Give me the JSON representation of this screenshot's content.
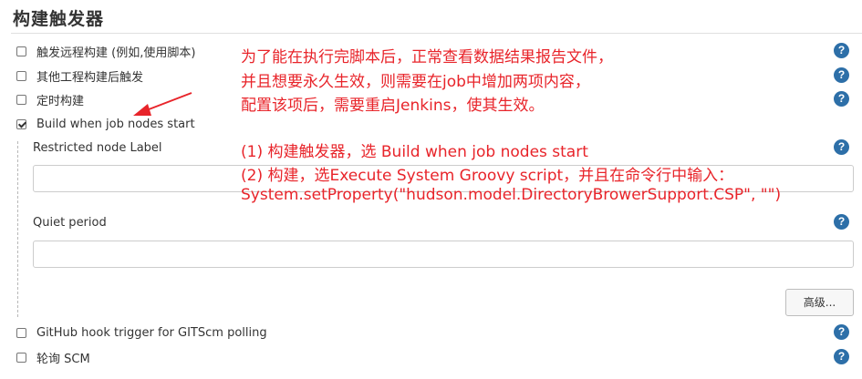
{
  "section": {
    "title": "构建触发器"
  },
  "options": [
    {
      "label": "触发远程构建 (例如,使用脚本)",
      "checked": false
    },
    {
      "label": "其他工程构建后触发",
      "checked": false
    },
    {
      "label": "定时构建",
      "checked": false
    },
    {
      "label": "Build when job nodes start",
      "checked": true
    }
  ],
  "nested": {
    "restricted_label": "Restricted node Label",
    "restricted_value": "",
    "quiet_label": "Quiet period",
    "quiet_value": "",
    "advanced_button": "高级..."
  },
  "options_bottom": [
    {
      "label": "GitHub hook trigger for GITScm polling",
      "checked": false
    },
    {
      "label": "轮询 SCM",
      "checked": false
    }
  ],
  "help_icon": {
    "glyph": "?",
    "color": "#2d6fa8"
  },
  "annotation": {
    "color": "#e8242a",
    "lines": [
      "为了能在执行完脚本后，正常查看数据结果报告文件，",
      "并且想要永久生效，则需要在job中增加两项内容，",
      "配置该项后，需要重启Jenkins，使其生效。",
      "(1) 构建触发器，选 Build when job nodes start",
      "(2) 构建，选Execute System Groovy script，并且在命令行中输入：",
      "System.setProperty(\"hudson.model.DirectoryBrowerSupport.CSP\", \"\")"
    ]
  }
}
